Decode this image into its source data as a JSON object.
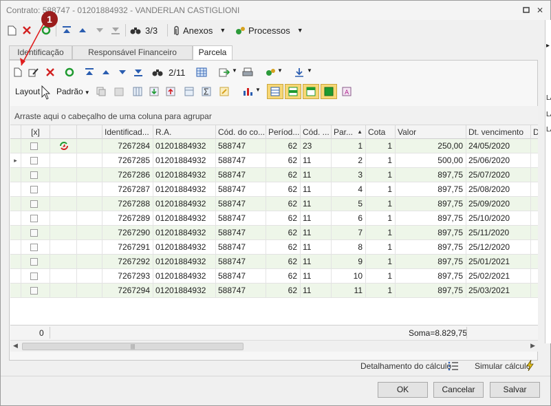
{
  "window": {
    "title": "Contrato: 588747 - 01201884932 - VANDERLAN CASTIGLIONI"
  },
  "toolbar": {
    "record_counter": "3/3",
    "anexos_label": "Anexos",
    "processos_label": "Processos"
  },
  "tabs": [
    {
      "label": "Identificação",
      "active": false
    },
    {
      "label": "Responsável Financeiro",
      "active": false
    },
    {
      "label": "Parcela",
      "active": true
    }
  ],
  "subtoolbar": {
    "record_counter": "2/11",
    "layout_label": "Layout",
    "padrao_label": "Padrão"
  },
  "annotation": {
    "badge": "1"
  },
  "grid": {
    "group_hint": "Arraste aqui o cabeçalho de uma coluna para agrupar",
    "columns": [
      "[x]",
      "",
      "",
      "Identificad...",
      "R.A.",
      "Cód. do co...",
      "Períod...",
      "Cód. ...",
      "Par...",
      "Cota",
      "Valor",
      "Dt. vencimento",
      "D"
    ],
    "rows": [
      {
        "id": "7267284",
        "ra": "01201884932",
        "cod_contrato": "588747",
        "periodo": "62",
        "cod": "23",
        "parcela": "1",
        "cota": "1",
        "valor": "250,00",
        "vencimento": "24/05/2020",
        "icon": "sync-status-icon",
        "indicator": ""
      },
      {
        "id": "7267285",
        "ra": "01201884932",
        "cod_contrato": "588747",
        "periodo": "62",
        "cod": "11",
        "parcela": "2",
        "cota": "1",
        "valor": "500,00",
        "vencimento": "25/06/2020",
        "icon": "",
        "indicator": "▸"
      },
      {
        "id": "7267286",
        "ra": "01201884932",
        "cod_contrato": "588747",
        "periodo": "62",
        "cod": "11",
        "parcela": "3",
        "cota": "1",
        "valor": "897,75",
        "vencimento": "25/07/2020",
        "icon": "",
        "indicator": ""
      },
      {
        "id": "7267287",
        "ra": "01201884932",
        "cod_contrato": "588747",
        "periodo": "62",
        "cod": "11",
        "parcela": "4",
        "cota": "1",
        "valor": "897,75",
        "vencimento": "25/08/2020",
        "icon": "",
        "indicator": ""
      },
      {
        "id": "7267288",
        "ra": "01201884932",
        "cod_contrato": "588747",
        "periodo": "62",
        "cod": "11",
        "parcela": "5",
        "cota": "1",
        "valor": "897,75",
        "vencimento": "25/09/2020",
        "icon": "",
        "indicator": ""
      },
      {
        "id": "7267289",
        "ra": "01201884932",
        "cod_contrato": "588747",
        "periodo": "62",
        "cod": "11",
        "parcela": "6",
        "cota": "1",
        "valor": "897,75",
        "vencimento": "25/10/2020",
        "icon": "",
        "indicator": ""
      },
      {
        "id": "7267290",
        "ra": "01201884932",
        "cod_contrato": "588747",
        "periodo": "62",
        "cod": "11",
        "parcela": "7",
        "cota": "1",
        "valor": "897,75",
        "vencimento": "25/11/2020",
        "icon": "",
        "indicator": ""
      },
      {
        "id": "7267291",
        "ra": "01201884932",
        "cod_contrato": "588747",
        "periodo": "62",
        "cod": "11",
        "parcela": "8",
        "cota": "1",
        "valor": "897,75",
        "vencimento": "25/12/2020",
        "icon": "",
        "indicator": ""
      },
      {
        "id": "7267292",
        "ra": "01201884932",
        "cod_contrato": "588747",
        "periodo": "62",
        "cod": "11",
        "parcela": "9",
        "cota": "1",
        "valor": "897,75",
        "vencimento": "25/01/2021",
        "icon": "",
        "indicator": ""
      },
      {
        "id": "7267293",
        "ra": "01201884932",
        "cod_contrato": "588747",
        "periodo": "62",
        "cod": "11",
        "parcela": "10",
        "cota": "1",
        "valor": "897,75",
        "vencimento": "25/02/2021",
        "icon": "",
        "indicator": ""
      },
      {
        "id": "7267294",
        "ra": "01201884932",
        "cod_contrato": "588747",
        "periodo": "62",
        "cod": "11",
        "parcela": "11",
        "cota": "1",
        "valor": "897,75",
        "vencimento": "25/03/2021",
        "icon": "",
        "indicator": ""
      }
    ],
    "footer_count": "0",
    "footer_sum": "Soma=8.829,75"
  },
  "links": {
    "detalhamento": "Detalhamento do cálculo",
    "simular": "Simular cálculo"
  },
  "buttons": {
    "ok": "OK",
    "cancelar": "Cancelar",
    "salvar": "Salvar"
  },
  "colors": {
    "accent_blue": "#2a5db0",
    "delete_red": "#d22020",
    "refresh_green": "#1e9a2f",
    "annotation_red": "#9b1c1c",
    "row_alt": "#eef6e9",
    "highlight_yellow": "#f7d775"
  }
}
